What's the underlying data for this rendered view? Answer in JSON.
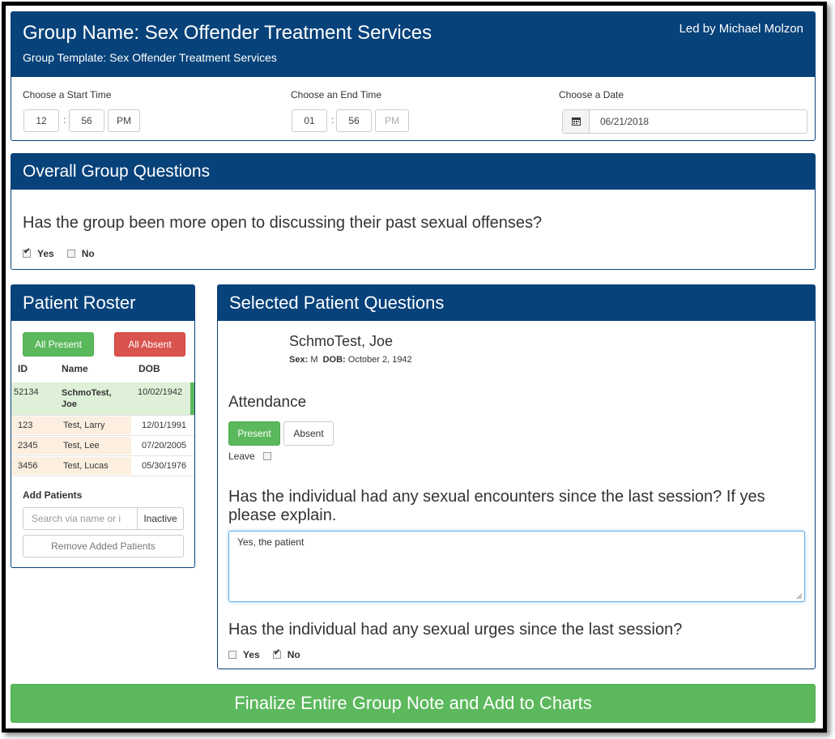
{
  "header": {
    "group_name": "Group Name: Sex Offender Treatment Services",
    "group_template": "Group Template: Sex Offender Treatment Services",
    "led_by": "Led by Michael Molzon"
  },
  "times": {
    "start": {
      "label": "Choose a Start Time",
      "hour": "12",
      "minute": "56",
      "ampm": "PM"
    },
    "end": {
      "label": "Choose an End Time",
      "hour": "01",
      "minute": "56",
      "ampm": "PM"
    },
    "date": {
      "label": "Choose a Date",
      "value": "06/21/2018",
      "icon": "calendar-icon"
    },
    "separator": ":"
  },
  "overall": {
    "title": "Overall Group Questions",
    "question": "Has the group been more open to discussing their past sexual offenses?",
    "yes_label": "Yes",
    "no_label": "No",
    "yes_checked": true,
    "no_checked": false
  },
  "roster": {
    "title": "Patient Roster",
    "all_present_label": "All Present",
    "all_absent_label": "All Absent",
    "columns": [
      "ID",
      "Name",
      "DOB"
    ],
    "rows": [
      {
        "id": "52134",
        "name": "SchmoTest, Joe",
        "dob": "10/02/1942",
        "selected": true
      },
      {
        "id": "123",
        "name": "Test, Larry",
        "dob": "12/01/1991",
        "selected": false
      },
      {
        "id": "2345",
        "name": "Test, Lee",
        "dob": "07/20/2005",
        "selected": false
      },
      {
        "id": "3456",
        "name": "Test, Lucas",
        "dob": "05/30/1976",
        "selected": false
      }
    ],
    "add_patients_label": "Add Patients",
    "search_placeholder": "Search via name or i",
    "inactive_label": "Inactive",
    "remove_label": "Remove Added Patients"
  },
  "selected_patient": {
    "title": "Selected Patient Questions",
    "name": "SchmoTest, Joe",
    "sex_label": "Sex:",
    "sex_value": "M",
    "dob_label": "DOB:",
    "dob_value": "October 2, 1942",
    "attendance_label": "Attendance",
    "present_label": "Present",
    "absent_label": "Absent",
    "leave_label": "Leave",
    "q1": "Has the individual had any sexual encounters since the last session? If yes please explain.",
    "q1_answer": "Yes, the patient",
    "q2": "Has the individual had any sexual urges since the last session?",
    "q2_yes_label": "Yes",
    "q2_no_label": "No",
    "q2_yes_checked": false,
    "q2_no_checked": true
  },
  "finalize_label": "Finalize Entire Group Note and Add to Charts",
  "colors": {
    "header_blue": "#07427a",
    "success_green": "#5cb85c",
    "danger_red": "#d9534f",
    "row_highlight": "#dff0d8",
    "row_peach": "#fcefe0"
  }
}
